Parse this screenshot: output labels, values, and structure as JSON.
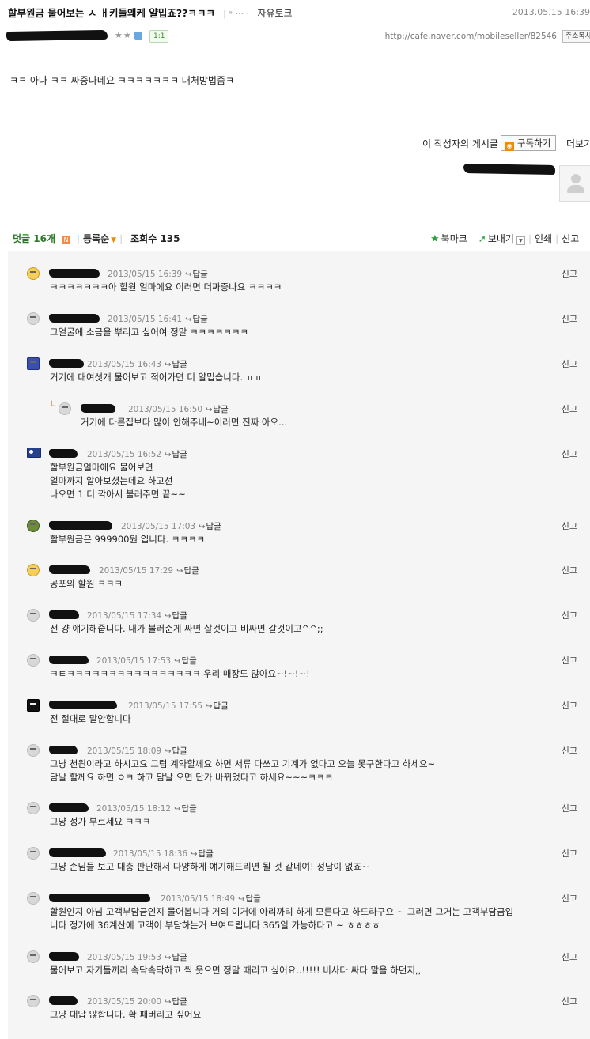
{
  "post": {
    "title": "할부원금 물어보는 ㅅ ㅐ키들왜케 얄밉죠??ㅋㅋㅋ",
    "title_separator": "| ᵉ ··· ·",
    "board": "자유토크",
    "date": "2013.05.15 16:39",
    "stars": "★★",
    "comment_badge": "1:1",
    "url": "http://cafe.naver.com/mobileseller/82546",
    "copy_url_label": "주소복사",
    "body": "ㅋㅋ 아나 ㅋㅋ 짜증나네요 ㅋㅋㅋㅋㅋㅋㅋ 대처방법좀ㅋ",
    "author_posts_label": "이 작성자의 게시글",
    "subscribe_label": "구독하기",
    "more_label": "더보기"
  },
  "comments_header": {
    "title": "덧글 16개",
    "new_badge": "N",
    "sort_label": "등록순",
    "views_label": "조회수 135"
  },
  "toolbar": {
    "bookmark": "북마크",
    "send": "보내기",
    "print": "인쇄",
    "report": "신고"
  },
  "reply_label": "답글",
  "report_label": "신고",
  "comments": [
    {
      "time": "2013/05/15 16:39",
      "lines": [
        "ㅋㅋㅋㅋㅋㅋㅋ아 할원 얼마에요 이러면 더짜증나요 ㅋㅋㅋㅋ"
      ]
    },
    {
      "time": "2013/05/15 16:41",
      "lines": [
        "그얼굴에 소금을 뿌리고 싶어여 정말 ㅋㅋㅋㅋㅋㅋㅋ"
      ]
    },
    {
      "time": "2013/05/15 16:43",
      "lines": [
        "거기에 대여섯개 물어보고 적어가면 더 얄밉습니다. ㅠㅠ"
      ]
    },
    {
      "time": "2013/05/15 16:50",
      "lines": [
        "거기에 다른집보다 많이 안해주네~이러면 진짜 아오..."
      ]
    },
    {
      "time": "2013/05/15 16:52",
      "lines": [
        "할부원금얼마에요 물어보면",
        "얼마까지 알아보셨는데요 하고선",
        "나오면 1 더 깍아서 불러주면 끝~~"
      ]
    },
    {
      "time": "2013/05/15 17:03",
      "lines": [
        "할부원금은 999900원 입니다. ㅋㅋㅋㅋ"
      ]
    },
    {
      "time": "2013/05/15 17:29",
      "lines": [
        "공포의 할원 ㅋㅋㅋ"
      ]
    },
    {
      "time": "2013/05/15 17:34",
      "lines": [
        "전 걍 얘기해줍니다. 내가 불러준게 싸면 살것이고 비싸면 갈것이고^^;;"
      ]
    },
    {
      "time": "2013/05/15 17:53",
      "lines": [
        "ㅋㅌㅋㅋㅋㅋㅋㅋㅋㅋㅋㅋㅋㅋㅋㅋㅋㅋ 우리 매장도 많아요~!~!~!"
      ]
    },
    {
      "time": "2013/05/15 17:55",
      "lines": [
        "전 절대로 말안합니다"
      ]
    },
    {
      "time": "2013/05/15 18:09",
      "lines": [
        "그냥 천원이라고 하시고요 그럼 계약할께요 하면 서류 다쓰고 기계가 없다고 오늘 못구한다고 하세요~",
        "담날 할께요 하면 ㅇㅋ 하고 담날 오면 단가 바뀌었다고 하세요~~~ㅋㅋㅋ"
      ]
    },
    {
      "time": "2013/05/15 18:12",
      "lines": [
        "그냥 정가 부르세요 ㅋㅋㅋ"
      ]
    },
    {
      "time": "2013/05/15 18:36",
      "lines": [
        "그냥 손님들 보고 대충 판단해서 다양하게 얘기해드리면 될 것 같네여! 정답이 없죠~"
      ]
    },
    {
      "time": "2013/05/15 18:49",
      "lines": [
        "할원인지 아님 고객부담금인지 물어봅니다 거의 이거에 아리까리 하게 모른다고 하드라구요 ~ 그러면 그거는 고객부담금입",
        "니다 정가에 36계산에 고객이 부담하는거 보여드립니다 365일 가능하다고 ~ ㅎㅎㅎㅎ"
      ]
    },
    {
      "time": "2013/05/15 19:53",
      "lines": [
        "물어보고 자기들끼리 속닥속닥하고 씩 웃으면 정말 때리고 싶어요..!!!!! 비사다 싸다 말을 하던지,,"
      ]
    },
    {
      "time": "2013/05/15 20:00",
      "lines": [
        "그냥 대답 않합니다. 확 패버리고 싶어요"
      ]
    }
  ],
  "colors": {
    "accent_green": "#2c7a2c",
    "comment_bg": "#f5f5f5",
    "rss_orange": "#f28b00"
  }
}
